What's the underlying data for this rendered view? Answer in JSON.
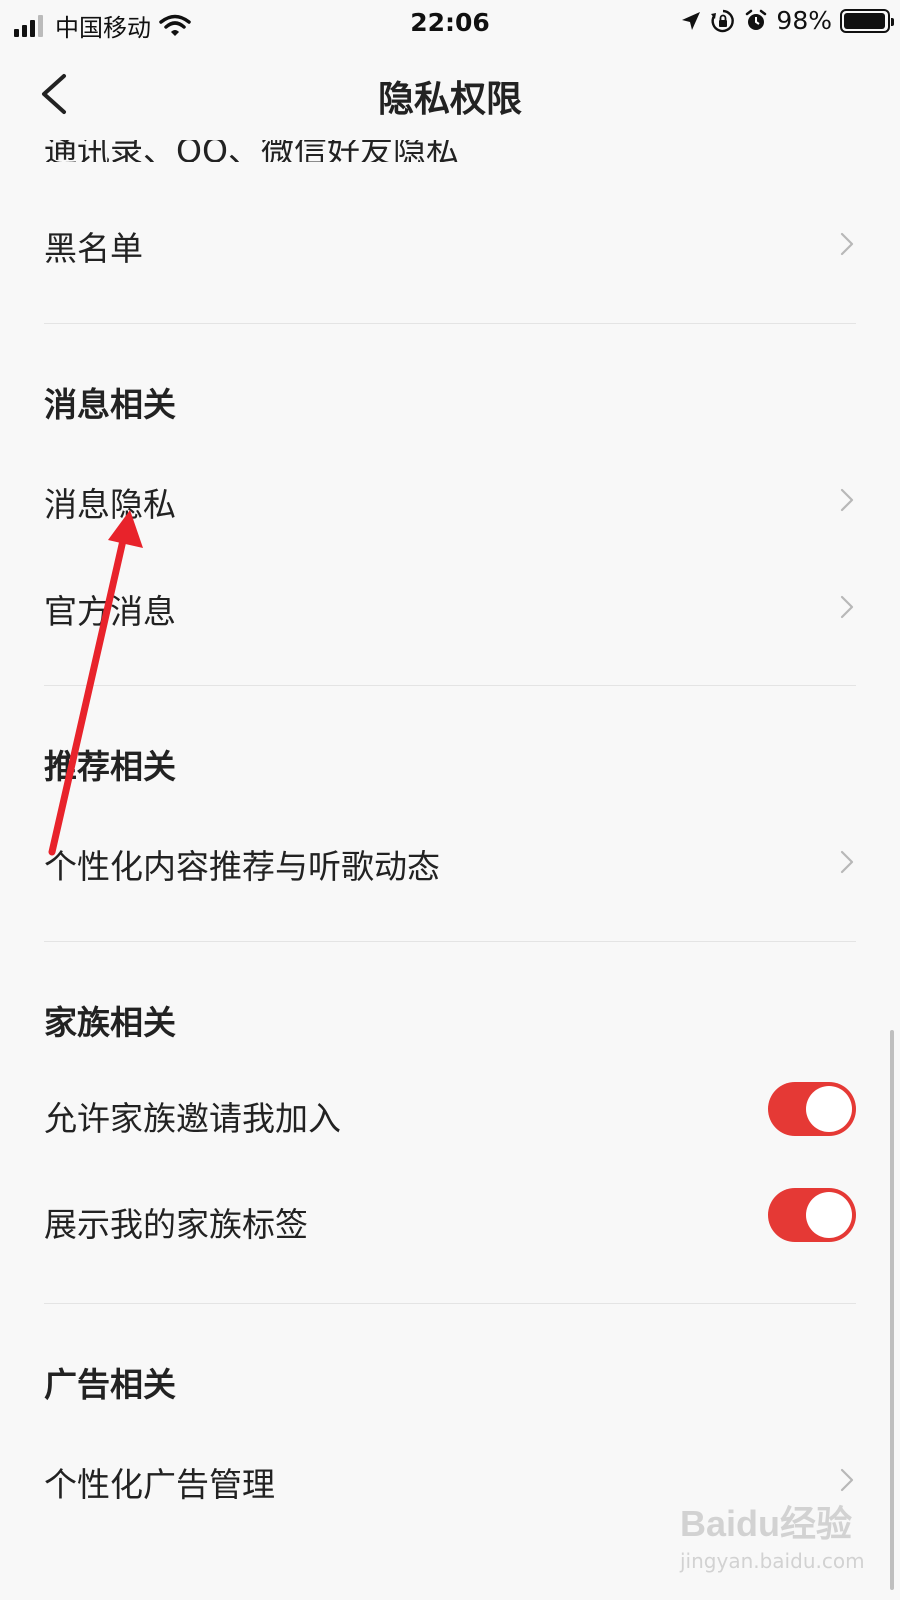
{
  "status_bar": {
    "carrier": "中国移动",
    "time": "22:06",
    "battery": "98%",
    "battery_level": 0.98
  },
  "nav": {
    "title": "隐私权限",
    "back_icon": "chevron-left-icon"
  },
  "list": {
    "cut_item": "通讯录、QQ、微信好友隐私",
    "blacklist": "黑名单",
    "sections": {
      "message": {
        "title": "消息相关",
        "items": [
          "消息隐私",
          "官方消息"
        ]
      },
      "recommend": {
        "title": "推荐相关",
        "items": [
          "个性化内容推荐与听歌动态"
        ]
      },
      "family": {
        "title": "家族相关",
        "toggles": [
          {
            "label": "允许家族邀请我加入",
            "on": true
          },
          {
            "label": "展示我的家族标签",
            "on": true
          }
        ]
      },
      "ads": {
        "title": "广告相关",
        "items": [
          "个性化广告管理"
        ]
      }
    }
  },
  "colors": {
    "accent": "#e53935",
    "annotation_arrow": "#e8232b"
  },
  "watermark": {
    "logo": "Baidu经验",
    "url": "jingyan.baidu.com"
  }
}
